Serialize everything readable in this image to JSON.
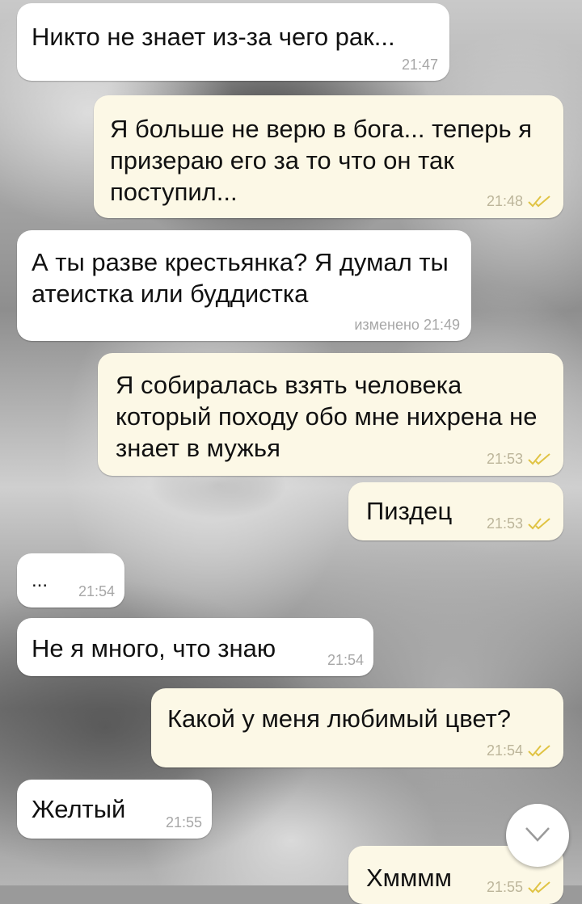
{
  "messages": [
    {
      "side": "in",
      "text": "Никто не знает из-за чего рак...",
      "time": "21:47"
    },
    {
      "side": "out",
      "text": "Я больше не верю в бога... теперь я призераю его за то что он так поступил...",
      "time": "21:48"
    },
    {
      "side": "in",
      "text": "А ты разве крестьянка? Я думал ты атеистка или буддистка",
      "edited": "изменено",
      "time": "21:49"
    },
    {
      "side": "out",
      "text": "Я собиралась взять человека который походу обо мне нихрена не знает в мужья",
      "time": "21:53"
    },
    {
      "side": "out",
      "text": "Пиздец",
      "time": "21:53"
    },
    {
      "side": "in",
      "text": "...",
      "time": "21:54"
    },
    {
      "side": "in",
      "text": "Не я много, что знаю",
      "time": "21:54"
    },
    {
      "side": "out",
      "text": "Какой у меня любимый цвет?",
      "time": "21:54"
    },
    {
      "side": "in",
      "text": "Желтый",
      "time": "21:55"
    },
    {
      "side": "out",
      "text": "Хмммм",
      "time": "21:55"
    }
  ],
  "icons": {
    "read_receipt": "double-check-icon",
    "scroll_down": "chevron-down-icon"
  },
  "colors": {
    "incoming_bubble": "#ffffff",
    "outgoing_bubble": "#fcf8e6",
    "check": "#e0c343",
    "time_text": "#a7a7a7"
  }
}
